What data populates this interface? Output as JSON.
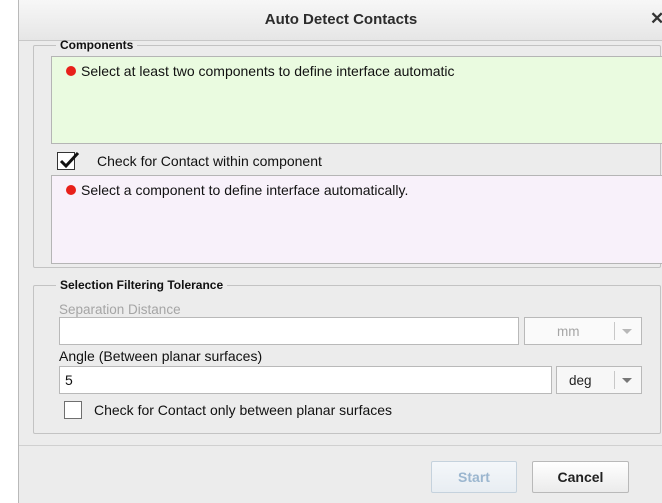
{
  "dialog": {
    "title": "Auto Detect Contacts",
    "close_icon": "close-icon"
  },
  "components": {
    "legend": "Components",
    "list_message": "Select at least two components to define interface automatic",
    "status_color": "#e8201a",
    "check_within": {
      "label": "Check for Contact within component",
      "checked": true
    },
    "list2_message": "Select a component to define interface automatically."
  },
  "tolerance": {
    "legend": "Selection Filtering Tolerance",
    "separation_label": "Separation Distance",
    "separation_value": "",
    "separation_unit": "mm",
    "angle_label": "Angle (Between planar surfaces)",
    "angle_value": "5",
    "angle_unit": "deg",
    "planar_check": {
      "label": "Check for Contact only between planar surfaces",
      "checked": false
    }
  },
  "buttons": {
    "start": "Start",
    "cancel": "Cancel"
  }
}
